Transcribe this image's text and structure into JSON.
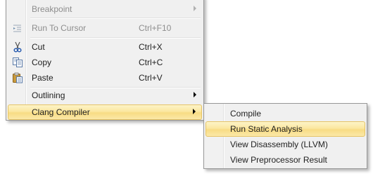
{
  "context_menu": {
    "items": [
      {
        "label": "Breakpoint",
        "shortcut": "",
        "icon": "",
        "enabled": false,
        "submenu": true
      },
      {
        "label": "Run To Cursor",
        "shortcut": "Ctrl+F10",
        "icon": "run-to-cursor-icon",
        "enabled": false,
        "submenu": false
      },
      {
        "label": "Cut",
        "shortcut": "Ctrl+X",
        "icon": "scissors-icon",
        "enabled": true,
        "submenu": false
      },
      {
        "label": "Copy",
        "shortcut": "Ctrl+C",
        "icon": "copy-icon",
        "enabled": true,
        "submenu": false
      },
      {
        "label": "Paste",
        "shortcut": "Ctrl+V",
        "icon": "paste-icon",
        "enabled": true,
        "submenu": false
      },
      {
        "label": "Outlining",
        "shortcut": "",
        "icon": "",
        "enabled": true,
        "submenu": true
      },
      {
        "label": "Clang Compiler",
        "shortcut": "",
        "icon": "",
        "enabled": true,
        "submenu": true,
        "highlighted": true
      }
    ]
  },
  "clang_submenu": {
    "items": [
      {
        "label": "Compile"
      },
      {
        "label": "Run Static Analysis",
        "highlighted": true
      },
      {
        "label": "View Disassembly (LLVM)"
      },
      {
        "label": "View Preprocessor Result"
      }
    ]
  },
  "colors": {
    "menu_background": "#f0f0f0",
    "highlight_top": "#fdf4c8",
    "highlight_bottom": "#f8dc84",
    "highlight_border": "#e5c365",
    "disabled_text": "#8d8d8d"
  }
}
